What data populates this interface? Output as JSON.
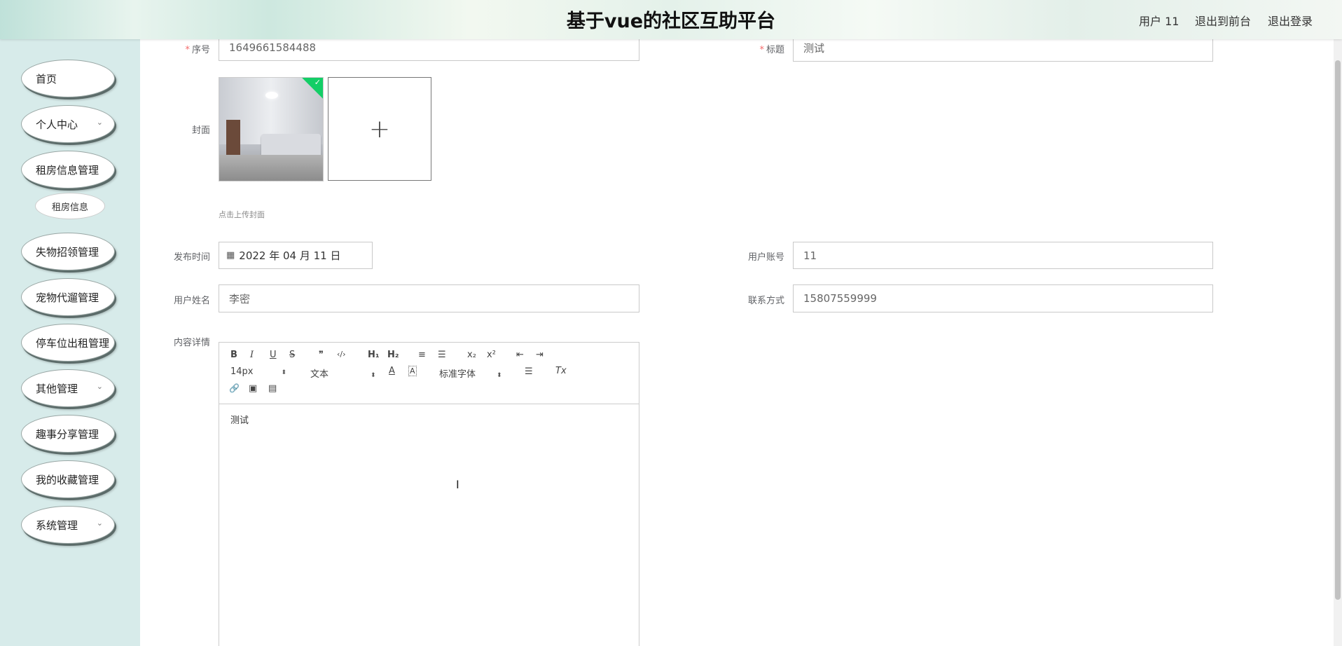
{
  "header": {
    "title": "基于vue的社区互助平台",
    "user_label": "用户 11",
    "back_to_front": "退出到前台",
    "logout": "退出登录"
  },
  "sidebar": {
    "items": [
      {
        "label": "首页",
        "has_arrow": false
      },
      {
        "label": "个人中心",
        "has_arrow": true
      },
      {
        "label": "租房信息管理",
        "has_arrow": false
      },
      {
        "label": "失物招领管理",
        "has_arrow": false
      },
      {
        "label": "宠物代遛管理",
        "has_arrow": false
      },
      {
        "label": "停车位出租管理",
        "has_arrow": false
      },
      {
        "label": "其他管理",
        "has_arrow": true
      },
      {
        "label": "趣事分享管理",
        "has_arrow": false
      },
      {
        "label": "我的收藏管理",
        "has_arrow": false
      },
      {
        "label": "系统管理",
        "has_arrow": true
      }
    ],
    "subitem": "租房信息",
    "chevron": "⌄"
  },
  "form": {
    "serial": {
      "label": "序号",
      "required_mark": "*",
      "value": "1649661584488"
    },
    "title": {
      "label": "标题",
      "required_mark": "*",
      "value": "测试"
    },
    "cover": {
      "label": "封面",
      "upload_tip": "点击上传封面",
      "plus": "+",
      "check": "✓"
    },
    "publish_time": {
      "label": "发布时间",
      "value": "2022 年 04 月 11 日",
      "icon": "calendar-icon"
    },
    "user_account": {
      "label": "用户账号",
      "value": "11"
    },
    "user_name": {
      "label": "用户姓名",
      "value": "李密"
    },
    "contact": {
      "label": "联系方式",
      "value": "15807559999"
    },
    "content": {
      "label": "内容详情",
      "body": "测试"
    }
  },
  "editor_toolbar": {
    "bold": "B",
    "italic": "I",
    "underline": "U",
    "strike": "S",
    "quote": "❞",
    "code": "‹/›",
    "h1": "H₁",
    "h2": "H₂",
    "ordered": "≡",
    "bullet": "☰",
    "sub": "x₂",
    "sup": "x²",
    "outdent": "⇤",
    "indent": "⇥",
    "size": "14px",
    "header": "文本",
    "font": "标准字体",
    "color": "A",
    "background": "A",
    "align": "☰",
    "clean": "Tx",
    "link": "🔗",
    "image": "▣",
    "video": "▤",
    "select_arrow": "⬍"
  }
}
